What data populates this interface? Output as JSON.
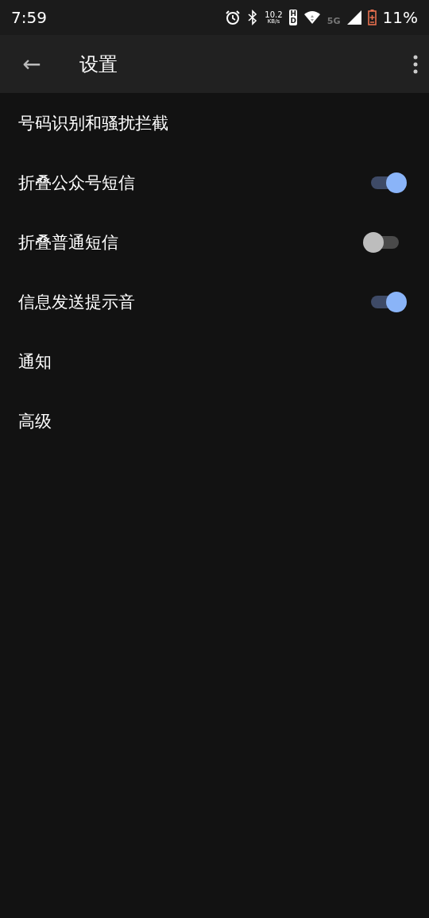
{
  "status_bar": {
    "time": "7:59",
    "speed": "10.2",
    "speed_unit": "KB/s",
    "hd_badge": "HD",
    "network": "5G",
    "battery": "11%"
  },
  "app_bar": {
    "back": "←",
    "title": "设置"
  },
  "settings": [
    {
      "kind": "link",
      "label": "号码识别和骚扰拦截"
    },
    {
      "kind": "toggle",
      "label": "折叠公众号短信",
      "on": true
    },
    {
      "kind": "toggle",
      "label": "折叠普通短信",
      "on": false
    },
    {
      "kind": "toggle",
      "label": "信息发送提示音",
      "on": true
    },
    {
      "kind": "link",
      "label": "通知"
    },
    {
      "kind": "link",
      "label": "高级"
    }
  ]
}
